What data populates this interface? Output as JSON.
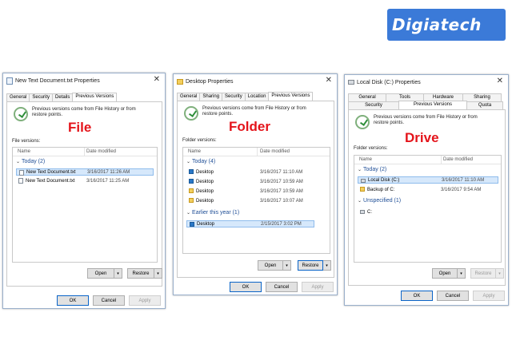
{
  "logo": {
    "text": "Digiatech"
  },
  "labels": {
    "file": "File",
    "folder": "Folder",
    "drive": "Drive"
  },
  "info_text": "Previous versions come from File History or from restore points.",
  "columns": {
    "name": "Name",
    "date": "Date modified"
  },
  "buttons": {
    "open": "Open",
    "restore": "Restore",
    "ok": "OK",
    "cancel": "Cancel",
    "apply": "Apply",
    "arrow": "▾"
  },
  "chevron": "⌄",
  "close": "✕",
  "file_dialog": {
    "title": "New Text Document.txt Properties",
    "tabs": [
      "General",
      "Security",
      "Details",
      "Previous Versions"
    ],
    "versions_label": "File versions:",
    "group": "Today (2)",
    "rows": [
      {
        "name": "New Text Document.txt",
        "date": "3/16/2017 11:26 AM"
      },
      {
        "name": "New Text Document.txt",
        "date": "3/16/2017 11:25 AM"
      }
    ]
  },
  "folder_dialog": {
    "title": "Desktop Properties",
    "tabs": [
      "General",
      "Sharing",
      "Security",
      "Location",
      "Previous Versions"
    ],
    "versions_label": "Folder versions:",
    "group1": "Today (4)",
    "rows1": [
      {
        "name": "Desktop",
        "date": "3/16/2017 11:10 AM"
      },
      {
        "name": "Desktop",
        "date": "3/16/2017 10:59 AM"
      },
      {
        "name": "Desktop",
        "date": "3/16/2017 10:59 AM"
      },
      {
        "name": "Desktop",
        "date": "3/16/2017 10:07 AM"
      }
    ],
    "group2": "Earlier this year (1)",
    "rows2": [
      {
        "name": "Desktop",
        "date": "2/15/2017 3:02 PM"
      }
    ]
  },
  "drive_dialog": {
    "title": "Local Disk (C:) Properties",
    "tabs_row1": [
      "General",
      "Tools",
      "Hardware",
      "Sharing"
    ],
    "tabs_row2": [
      "Security",
      "Previous Versions",
      "Quota"
    ],
    "versions_label": "Folder versions:",
    "group1": "Today (2)",
    "rows1": [
      {
        "name": "Local Disk (C:)",
        "date": "3/16/2017 11:10 AM"
      },
      {
        "name": "Backup of C:",
        "date": "3/16/2017 9:54 AM"
      }
    ],
    "group2": "Unspecified (1)",
    "rows2": [
      {
        "name": "C:",
        "date": ""
      }
    ]
  }
}
